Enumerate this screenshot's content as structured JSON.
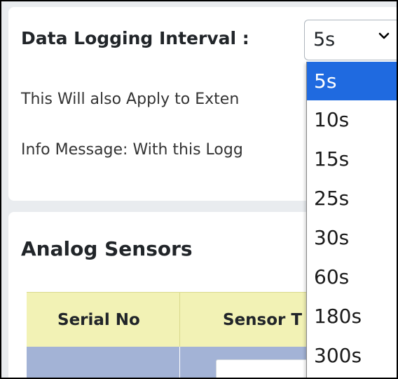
{
  "logging": {
    "label": "Data Logging Interval :",
    "selected_value": "5s",
    "options": [
      "5s",
      "10s",
      "15s",
      "25s",
      "30s",
      "60s",
      "180s",
      "300s"
    ]
  },
  "notes": {
    "apply_text": "This Will also Apply to Exten",
    "info_text": "Info Message: With this Logg"
  },
  "analog_section": {
    "title": "Analog Sensors",
    "columns": [
      "Serial No",
      "Sensor T"
    ]
  },
  "colors": {
    "selected_option": "#1f6ae0",
    "table_header": "#f2f2b5",
    "table_row": "#a3b3d6"
  }
}
